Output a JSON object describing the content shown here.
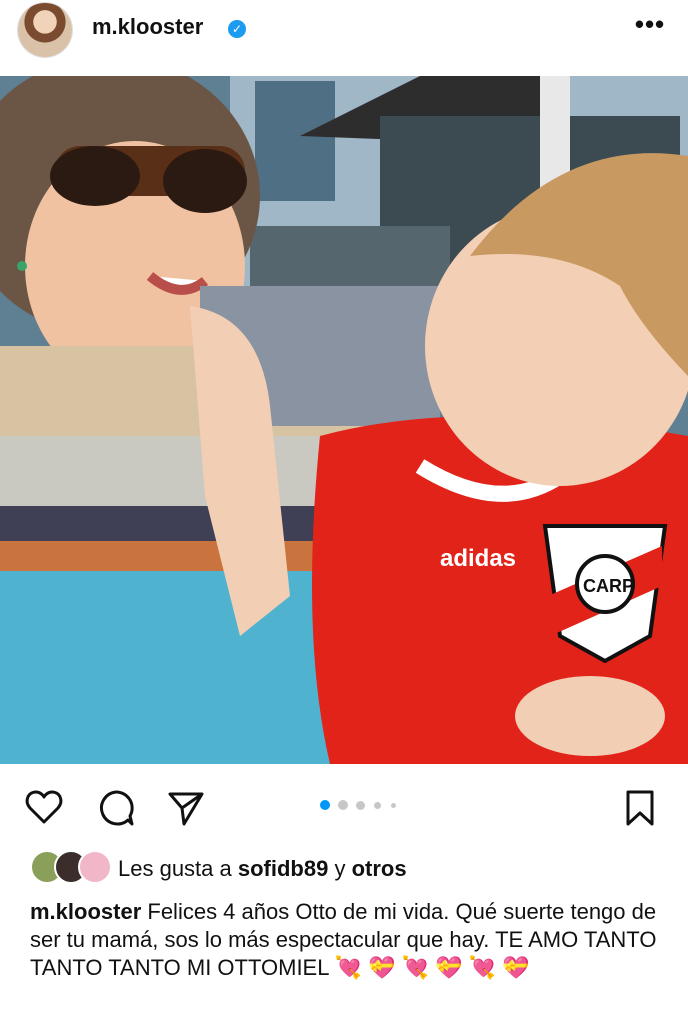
{
  "post": {
    "username": "m.klooster",
    "verified": true,
    "more_icon": "more-horizontal-icon",
    "image_description_icon": "photo",
    "carousel": {
      "total": 5,
      "current": 1
    },
    "likes": {
      "prefix": "Les gusta a ",
      "user": "sofidb89",
      "middle": " y ",
      "suffix": "otros"
    },
    "caption": {
      "username": "m.klooster",
      "text": " Felices 4 años Otto de mi vida. Qué suerte tengo de ser tu mamá, sos lo más espectacular que hay. TE AMO TANTO TANTO TANTO MI OTTOMIEL 💘 💝 💘 💝 💘 💝"
    },
    "shirt_text": "adidas",
    "crest_text": "CARP"
  },
  "colors": {
    "accent_blue": "#0095f6",
    "verified_blue": "#1d9bf0",
    "jersey_red": "#e2231a"
  }
}
